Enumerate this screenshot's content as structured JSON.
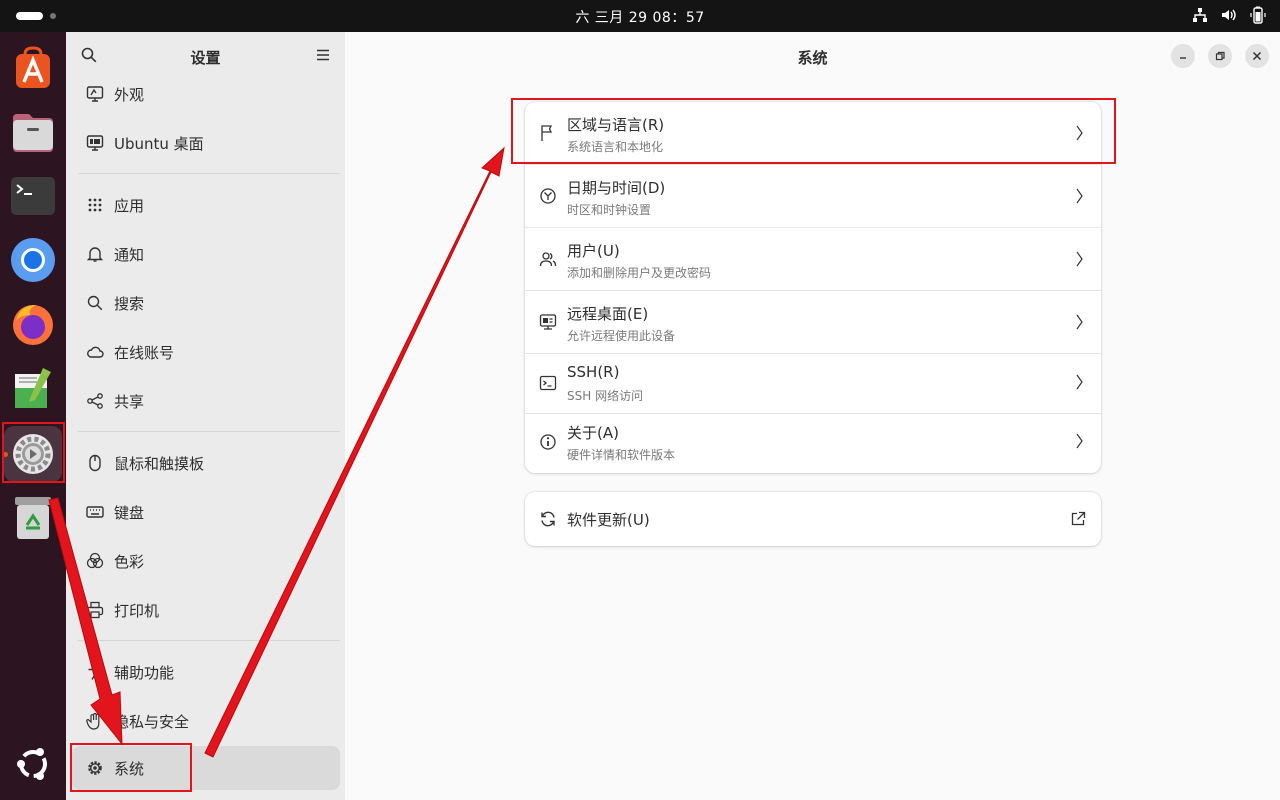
{
  "topbar": {
    "clock": "六 三月 29  08：57"
  },
  "dock": {
    "apps": [
      {
        "name": "app-center-icon"
      },
      {
        "name": "files-icon"
      },
      {
        "name": "terminal-icon"
      },
      {
        "name": "chromium-icon"
      },
      {
        "name": "firefox-icon"
      },
      {
        "name": "text-editor-icon"
      },
      {
        "name": "settings-icon"
      },
      {
        "name": "trash-icon"
      }
    ],
    "show_apps_icon": "ubuntu-logo-icon"
  },
  "sidebar": {
    "title": "设置",
    "items": [
      {
        "label": "外观",
        "icon": "appearance-icon"
      },
      {
        "label": "Ubuntu 桌面",
        "icon": "ubuntu-desktop-icon"
      },
      {
        "label": "应用",
        "icon": "apps-grid-icon"
      },
      {
        "label": "通知",
        "icon": "bell-icon"
      },
      {
        "label": "搜索",
        "icon": "search-icon"
      },
      {
        "label": "在线账号",
        "icon": "cloud-icon"
      },
      {
        "label": "共享",
        "icon": "share-icon"
      },
      {
        "label": "鼠标和触摸板",
        "icon": "mouse-icon"
      },
      {
        "label": "键盘",
        "icon": "keyboard-icon"
      },
      {
        "label": "色彩",
        "icon": "color-icon"
      },
      {
        "label": "打印机",
        "icon": "printer-icon"
      },
      {
        "label": "辅助功能",
        "icon": "accessibility-icon"
      },
      {
        "label": "隐私与安全",
        "icon": "hand-icon"
      },
      {
        "label": "系统",
        "icon": "gear-icon"
      }
    ],
    "selected": "系统"
  },
  "main": {
    "title": "系统",
    "rows": [
      {
        "title": "区域与语言(R)",
        "subtitle": "系统语言和本地化",
        "icon": "flag-icon"
      },
      {
        "title": "日期与时间(D)",
        "subtitle": "时区和时钟设置",
        "icon": "clock-icon"
      },
      {
        "title": "用户(U)",
        "subtitle": "添加和删除用户及更改密码",
        "icon": "users-icon"
      },
      {
        "title": "远程桌面(E)",
        "subtitle": "允许远程使用此设备",
        "icon": "remote-desktop-icon"
      },
      {
        "title": "SSH(R)",
        "subtitle": "SSH 网络访问",
        "icon": "terminal-icon"
      },
      {
        "title": "关于(A)",
        "subtitle": "硬件详情和软件版本",
        "icon": "info-icon"
      }
    ],
    "update": {
      "title": "软件更新(U)",
      "icon": "refresh-icon",
      "action_icon": "external-link-icon"
    }
  },
  "colors": {
    "annotation": "#e3141b",
    "accent": "#e95420",
    "topbar": "#141414",
    "dock": "#2c1420"
  }
}
